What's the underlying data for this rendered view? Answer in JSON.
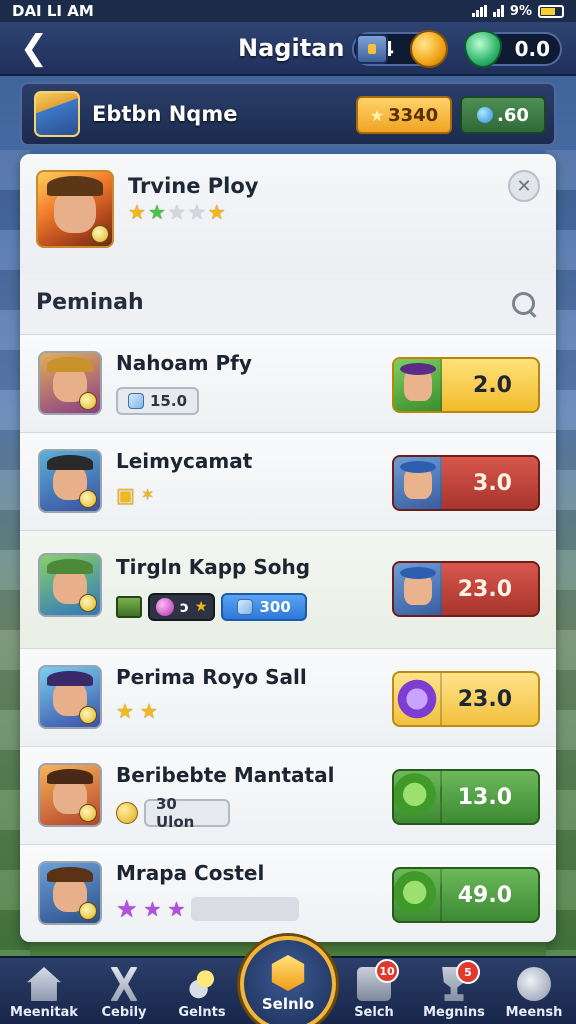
{
  "status_bar": {
    "time": "DAI LI AM",
    "battery": "9%"
  },
  "header": {
    "title": "Nagitan",
    "coins_value": "4",
    "gems_value": "0.0",
    "back_icon": "back-arrow-icon"
  },
  "profile": {
    "name": "Ebtbn Nqme",
    "gold_value": "3340",
    "gem_value": ".60"
  },
  "featured": {
    "title": "Trvine Ploy",
    "stars": [
      "gold",
      "green",
      "grey",
      "grey",
      "gold"
    ]
  },
  "section": {
    "title": "Peminah"
  },
  "games": [
    {
      "title": "Nahoam Pfy",
      "sub_type": "chip_grey",
      "sub_text": "15.0",
      "price": "2.0",
      "price_style": "yellow"
    },
    {
      "title": "Leimycamat",
      "sub_type": "icons",
      "price": "3.0",
      "price_style": "red"
    },
    {
      "title": "Tirgln Kapp Sohg",
      "sub_type": "mixed",
      "sub_text_small": "ɔ",
      "sub_text": "300",
      "price": "23.0",
      "price_style": "red"
    },
    {
      "title": "Perima Royo Sall",
      "sub_type": "stars",
      "price": "23.0",
      "price_style": "gold"
    },
    {
      "title": "Beribebte Mantatal",
      "sub_type": "coin_chip",
      "sub_text": "30 Ulon",
      "price": "13.0",
      "price_style": "green"
    },
    {
      "title": "Mrapa Costel",
      "sub_type": "purple_stars",
      "price": "49.0",
      "price_style": "green"
    }
  ],
  "bottom_nav": {
    "items": [
      {
        "label": "Meenitak",
        "icon": "home-icon"
      },
      {
        "label": "Cebily",
        "icon": "swords-icon"
      },
      {
        "label": "Gelnts",
        "icon": "coins-icon"
      },
      {
        "label": "Selnlo",
        "icon": "hexagon-icon"
      },
      {
        "label": "Selch",
        "icon": "chest-icon",
        "badge": "10"
      },
      {
        "label": "Megnins",
        "icon": "trophy-icon",
        "badge": "5"
      },
      {
        "label": "Meensh",
        "icon": "globe-icon"
      }
    ]
  },
  "colors": {
    "accent_gold": "#f2b73a",
    "panel_bg": "#f2f4f7",
    "header_bg": "#1f305a"
  }
}
